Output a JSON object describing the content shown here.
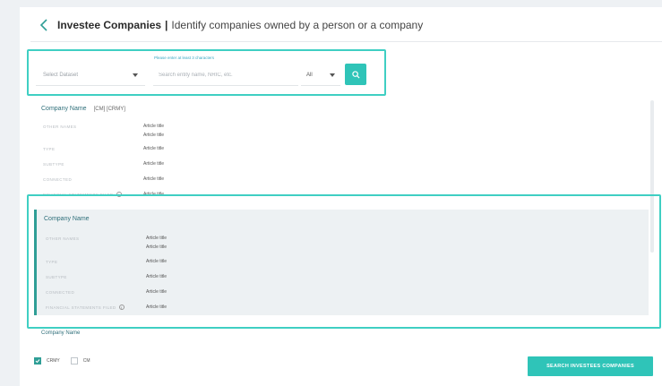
{
  "header": {
    "title": "Investee Companies",
    "separator": "|",
    "description": "Identify companies owned by a person or a company"
  },
  "search": {
    "hint": "Please enter at least 3 characters",
    "dataset_placeholder": "Select Dataset",
    "query_placeholder": "Search entity name, NRIC, etc.",
    "scope_value": "All"
  },
  "results": {
    "card1": {
      "company_name": "Company Name",
      "codes": "[CM] [CRMY]",
      "fields": [
        {
          "label": "OTHER NAMES",
          "values": [
            "Article title",
            "Article title"
          ]
        },
        {
          "label": "TYPE",
          "values": [
            "Article title"
          ]
        },
        {
          "label": "SUBTYPE",
          "values": [
            "Article title"
          ]
        },
        {
          "label": "CONNECTED",
          "values": [
            "Article title"
          ]
        },
        {
          "label": "FINANCIAL STATEMENTS FILED",
          "values": [
            "Article title"
          ]
        }
      ]
    },
    "card2": {
      "company_name": "Company Name",
      "fields": [
        {
          "label": "OTHER NAMES",
          "values": [
            "Article title",
            "Article title"
          ]
        },
        {
          "label": "TYPE",
          "values": [
            "Article title"
          ]
        },
        {
          "label": "SUBTYPE",
          "values": [
            "Article title"
          ]
        },
        {
          "label": "CONNECTED",
          "values": [
            "Article title"
          ]
        },
        {
          "label": "FINANCIAL STATEMENTS FILED",
          "values": [
            "Article title"
          ]
        }
      ]
    },
    "card3": {
      "company_name": "Company Name"
    }
  },
  "filters": {
    "crmy_label": "CRMY",
    "crmy_checked": true,
    "cm_label": "CM",
    "cm_checked": false
  },
  "action": {
    "label": "SEARCH INVESTEES COMPANIES"
  },
  "colors": {
    "accent": "#2fc4b8",
    "highlight": "#3fcfc3",
    "card_bg": "#edf1f3"
  },
  "icons": {
    "back": "chevron-left-icon",
    "search": "search-icon",
    "info": "info-icon"
  }
}
